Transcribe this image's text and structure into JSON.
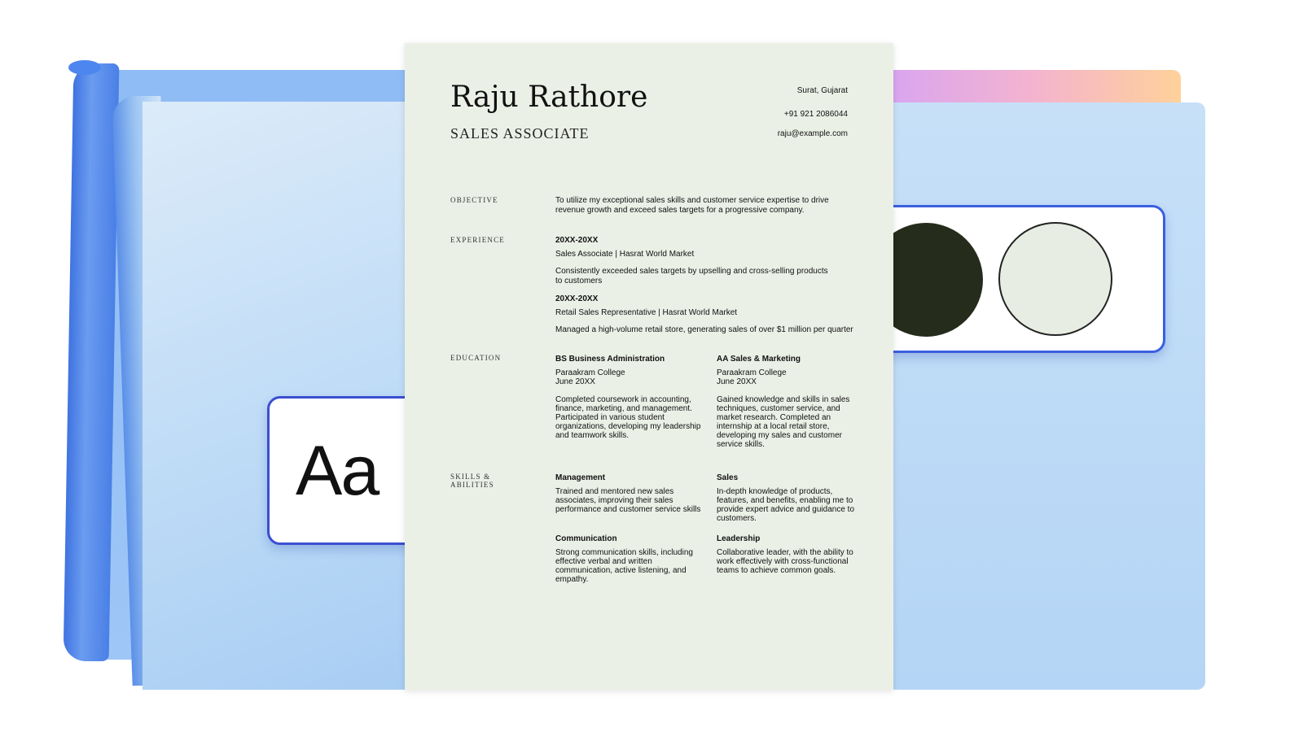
{
  "font_card": {
    "sample": "Aa"
  },
  "resume": {
    "name": "Raju Rathore",
    "title": "SALES ASSOCIATE",
    "contact": {
      "location": "Surat, Gujarat",
      "phone": "+91 921 2086044",
      "email": "raju@example.com"
    },
    "objective": {
      "label": "OBJECTIVE",
      "text": "To utilize my exceptional sales skills and customer service expertise to drive revenue growth and exceed sales targets for a progressive company."
    },
    "experience": {
      "label": "EXPERIENCE",
      "items": [
        {
          "dates": "20XX-20XX",
          "role": "Sales Associate | Hasrat World Market",
          "desc": "Consistently exceeded sales targets by upselling and cross-selling products to customers"
        },
        {
          "dates": "20XX-20XX",
          "role": "Retail Sales Representative | Hasrat World Market",
          "desc": "Managed a high-volume retail store, generating sales of over $1 million per quarter"
        }
      ]
    },
    "education": {
      "label": "EDUCATION",
      "items": [
        {
          "degree": "BS Business Administration",
          "school": "Paraakram College",
          "date": "June 20XX",
          "desc": "Completed coursework in accounting, finance, marketing, and management. Participated in various student organizations, developing my leadership and teamwork skills."
        },
        {
          "degree": "AA Sales & Marketing",
          "school": "Paraakram College",
          "date": "June 20XX",
          "desc": "Gained knowledge and skills in sales techniques, customer service, and market research. Completed an internship at a local retail store, developing my sales and customer service skills."
        }
      ]
    },
    "skills": {
      "label_line1": "SKILLS &",
      "label_line2": "ABILITIES",
      "items": [
        {
          "name": "Management",
          "desc": "Trained and mentored new sales associates, improving their sales performance and customer service skills"
        },
        {
          "name": "Sales",
          "desc": "In-depth knowledge of products, features, and benefits, enabling me to provide expert advice and guidance to customers."
        },
        {
          "name": "Communication",
          "desc": "Strong communication skills, including effective verbal and written communication, active listening, and empathy."
        },
        {
          "name": "Leadership",
          "desc": "Collaborative leader, with the ability to work effectively with cross-functional teams to achieve common goals."
        }
      ]
    }
  },
  "palette": {
    "dark": "#252c1b",
    "light": "#e7ede2"
  }
}
